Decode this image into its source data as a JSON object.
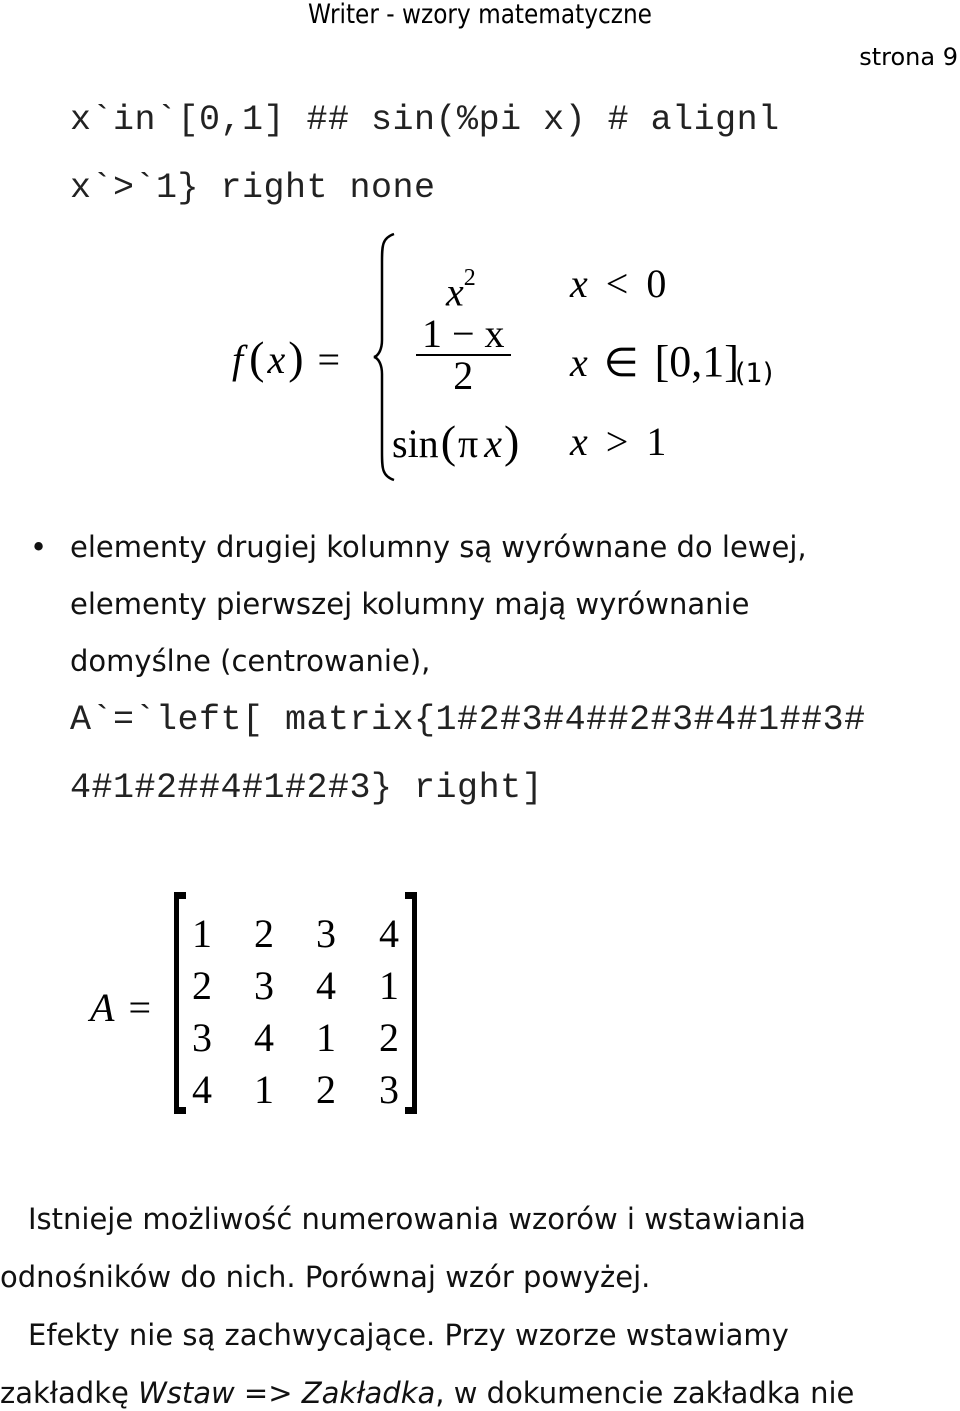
{
  "header": {
    "title": "Writer - wzory matematyczne",
    "page_label": "strona 9"
  },
  "code_lines_top": [
    "x`in`[0,1] ## sin(%pi x) # alignl",
    "x`>`1} right none"
  ],
  "formula1": {
    "lhs_f": "f",
    "lhs_open": "(",
    "lhs_x": "x",
    "lhs_close": ")",
    "equals": "=",
    "cases": [
      {
        "expr_base": "x",
        "expr_sup": "2",
        "cond_var": "x",
        "cond_op": "<",
        "cond_val": "0"
      },
      {
        "frac_num": "1 − x",
        "frac_den": "2",
        "cond_var": "x",
        "cond_op": "∈",
        "cond_val": "[0,1]"
      },
      {
        "expr_fn": "sin",
        "expr_open": "(",
        "expr_pi": "π",
        "expr_x": "x",
        "expr_close": ")",
        "cond_var": "x",
        "cond_op": ">",
        "cond_val": "1"
      }
    ],
    "number": "(1)"
  },
  "bullet": {
    "symbol": "•",
    "lines": [
      "elementy drugiej kolumny są wyrównane do lewej,",
      "elementy pierwszej kolumny mają wyrównanie",
      "domyślne (centrowanie),"
    ],
    "code_lines": [
      "A`=`left[ matrix{1#2#3#4##2#3#4#1##3#",
      "4#1#2##4#1#2#3} right]"
    ]
  },
  "matrix": {
    "lhs": "A",
    "equals": "=",
    "rows": [
      [
        "1",
        "2",
        "3",
        "4"
      ],
      [
        "2",
        "3",
        "4",
        "1"
      ],
      [
        "3",
        "4",
        "1",
        "2"
      ],
      [
        "4",
        "1",
        "2",
        "3"
      ]
    ]
  },
  "paragraphs": {
    "p1_line1": "Istnieje możliwość numerowania wzorów i wstawiania",
    "p1_line2": "odnośników do nich. Porównaj wzór powyżej.",
    "p2_line1": "Efekty nie są zachwycające. Przy wzorze wstawiamy",
    "p2_line2_a": "zakładkę ",
    "p2_line2_b": "Wstaw",
    "p2_line2_c": " => ",
    "p2_line2_d": "Zakładka",
    "p2_line2_e": ", w dokumencie zakładka nie"
  }
}
